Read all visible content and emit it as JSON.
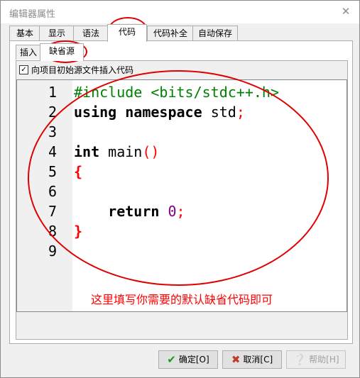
{
  "window": {
    "title": "编辑器属性",
    "close_glyph": "✕"
  },
  "tabs": [
    {
      "label": "基本"
    },
    {
      "label": "显示"
    },
    {
      "label": "语法"
    },
    {
      "label": "代码",
      "active": true
    },
    {
      "label": "代码补全"
    },
    {
      "label": "自动保存"
    }
  ],
  "subtabs": [
    {
      "label": "插入"
    },
    {
      "label": "缺省源",
      "active": true
    }
  ],
  "insert_checkbox": {
    "label": "向项目初始源文件插入代码",
    "checked": true,
    "check_glyph": "✓"
  },
  "editor": {
    "line_numbers": [
      "1",
      "2",
      "3",
      "4",
      "5",
      "6",
      "7",
      "8",
      "9"
    ],
    "code": {
      "l1": "#include <bits/stdc++.h>",
      "l2_kw1": "using",
      "l2_kw2": "namespace",
      "l2_id": "std",
      "l2_semi": ";",
      "l4_kw": "int",
      "l4_id": "main",
      "l4_paren": "()",
      "l5_brace": "{",
      "l7_kw": "return",
      "l7_num": "0",
      "l7_semi": ";",
      "l8_brace": "}"
    }
  },
  "annotation": "这里填写你需要的默认缺省代码即可",
  "buttons": {
    "ok": {
      "label": "确定[O]",
      "icon": "check-icon"
    },
    "cancel": {
      "label": "取消[C]",
      "icon": "cross-icon"
    },
    "help": {
      "label": "帮助[H]",
      "icon": "question-icon"
    }
  },
  "colors": {
    "annotation_red": "#e00000",
    "preprocessor": "#008000",
    "number": "#800080"
  }
}
